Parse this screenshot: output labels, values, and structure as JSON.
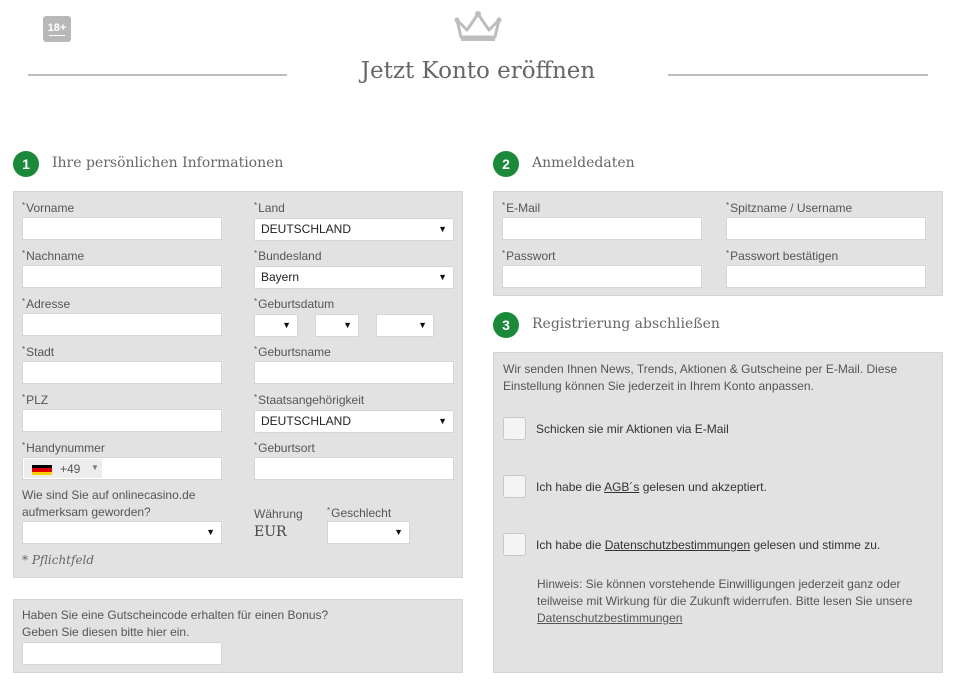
{
  "header": {
    "age_badge": "18+",
    "title": "Jetzt Konto eröffnen"
  },
  "section1": {
    "number": "1",
    "title": "Ihre persönlichen Informationen",
    "fields": {
      "vorname": "Vorname",
      "land": "Land",
      "land_value": "DEUTSCHLAND",
      "nachname": "Nachname",
      "bundesland": "Bundesland",
      "bundesland_value": "Bayern",
      "adresse": "Adresse",
      "geburtsdatum": "Geburtsdatum",
      "stadt": "Stadt",
      "geburtsname": "Geburtsname",
      "plz": "PLZ",
      "staatsangehoerigkeit": "Staatsangehörigkeit",
      "staatsangehoerigkeit_value": "DEUTSCHLAND",
      "handynummer": "Handynummer",
      "phone_code": "+49",
      "geburtsort": "Geburtsort",
      "source_question_line1": "Wie sind Sie auf onlinecasino.de",
      "source_question_line2": "aufmerksam geworden?",
      "waehrung": "Währung",
      "waehrung_value": "EUR",
      "geschlecht": "Geschlecht"
    },
    "required_note": "* Pflichtfeld",
    "required_mark": "*"
  },
  "voucher": {
    "line1": "Haben Sie eine Gutscheincode erhalten für einen Bonus?",
    "line2": "Geben Sie diesen bitte hier ein."
  },
  "section2": {
    "number": "2",
    "title": "Anmeldedaten",
    "fields": {
      "email": "E-Mail",
      "username": "Spitzname / Username",
      "password": "Passwort",
      "password_confirm": "Passwort bestätigen"
    }
  },
  "section3": {
    "number": "3",
    "title": "Registrierung abschließen",
    "intro_line1": "Wir senden Ihnen News, Trends, Aktionen & Gutscheine per E-Mail. Diese",
    "intro_line2": "Einstellung können Sie jederzeit in Ihrem Konto anpassen.",
    "checkbox_newsletter": "Schicken sie mir Aktionen via E-Mail",
    "agb_prefix": "Ich habe die ",
    "agb_link": "AGB´s",
    "agb_suffix": " gelesen und akzeptiert.",
    "privacy_prefix": "Ich habe die ",
    "privacy_link": "Datenschutzbestimmungen",
    "privacy_suffix": " gelesen und stimme zu.",
    "hint_line1": "Hinweis: Sie können vorstehende Einwilligungen jederzeit ganz oder",
    "hint_line2": "teilweise mit Wirkung für die Zukunft widerrufen. Bitte lesen Sie unsere",
    "hint_link": "Datenschutzbestimmungen"
  },
  "icons": {
    "crown": "crown-icon",
    "dropdown": "chevron-down-icon",
    "flag": "flag-de-icon"
  },
  "colors": {
    "accent_green": "#1a8a3a",
    "panel_bg": "#e2e2e2"
  }
}
